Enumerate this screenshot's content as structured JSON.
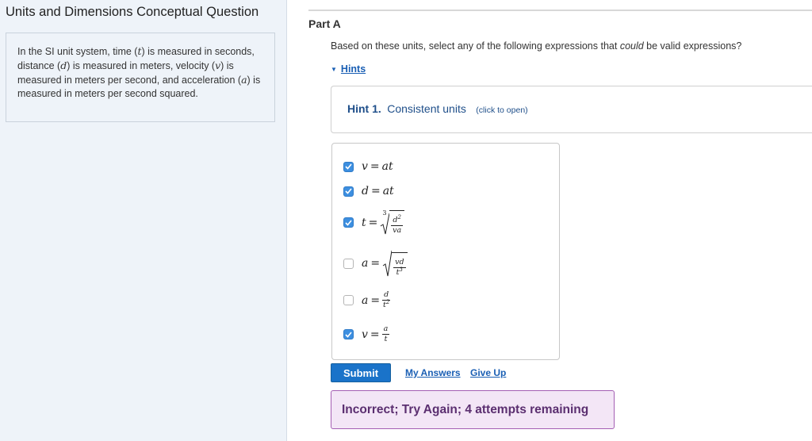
{
  "left_panel": {
    "title": "Units and Dimensions Conceptual Question",
    "intro": {
      "p1": "In the SI unit system, time (",
      "t": "t",
      "p2": ") is measured in seconds, distance (",
      "d": "d",
      "p3": ") is measured in meters, velocity (",
      "v": "v",
      "p4": ") is measured in meters per second, and acceleration (",
      "a": "a",
      "p5": ") is measured in meters per second squared."
    }
  },
  "part": {
    "label": "Part A",
    "question_pre": "Based on these units, select any of the following expressions that ",
    "question_em": "could",
    "question_post": " be valid expressions?",
    "hints_label": "Hints",
    "hint": {
      "number": "Hint 1.",
      "title": "Consistent units",
      "open_text": "(click to open)"
    }
  },
  "options": [
    {
      "expression": "v = at",
      "checked": true
    },
    {
      "expression": "d = at",
      "checked": true
    },
    {
      "expression": "t = ∛(d²/(va))",
      "checked": true
    },
    {
      "expression": "a = √(vd/t³)",
      "checked": false
    },
    {
      "expression": "a = d/t²",
      "checked": false
    },
    {
      "expression": "v = a/t",
      "checked": true
    }
  ],
  "actions": {
    "submit_label": "Submit",
    "my_answers_label": "My Answers",
    "give_up_label": "Give Up"
  },
  "feedback": {
    "text": "Incorrect; Try Again; 4 attempts remaining"
  },
  "colors": {
    "accent": "#1a73c9",
    "link": "#1a5fb4",
    "checkbox_checked": "#3d8fe0",
    "feedback_bg": "#f3e6f6",
    "feedback_border": "#a45fb3",
    "feedback_text": "#5b2f70"
  },
  "icons": {
    "hints_toggle": "caret-down-icon",
    "checkbox": "check-icon"
  }
}
